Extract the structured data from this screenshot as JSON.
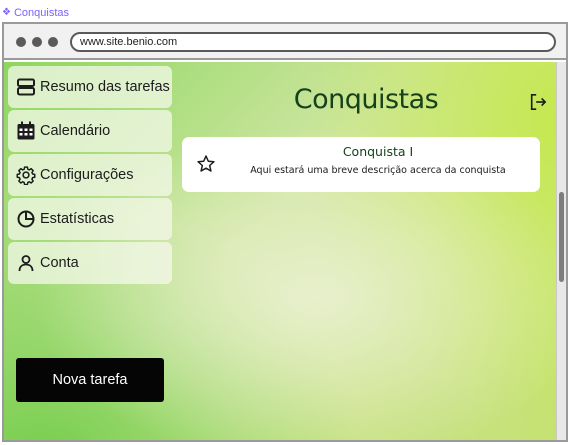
{
  "frame": {
    "label": "Conquistas",
    "label_color": "#7b61ff"
  },
  "browser": {
    "url": "www.site.benio.com"
  },
  "sidebar": {
    "items": [
      {
        "label": "Resumo das tarefas",
        "icon": "summary-icon"
      },
      {
        "label": "Calendário",
        "icon": "calendar-icon"
      },
      {
        "label": "Configurações",
        "icon": "gear-icon"
      },
      {
        "label": "Estatísticas",
        "icon": "pie-chart-icon"
      },
      {
        "label": "Conta",
        "icon": "user-icon"
      }
    ],
    "new_task_label": "Nova tarefa"
  },
  "main": {
    "title": "Conquistas",
    "logout_icon": "logout-icon",
    "achievements": [
      {
        "title": "Conquista I",
        "description": "Aqui estará uma breve descrição acerca da conquista",
        "icon": "star-icon"
      }
    ]
  },
  "colors": {
    "title": "#17411b",
    "button_bg": "#050505",
    "gradient_green": "#8ed660",
    "gradient_lime": "#c3e45e"
  }
}
